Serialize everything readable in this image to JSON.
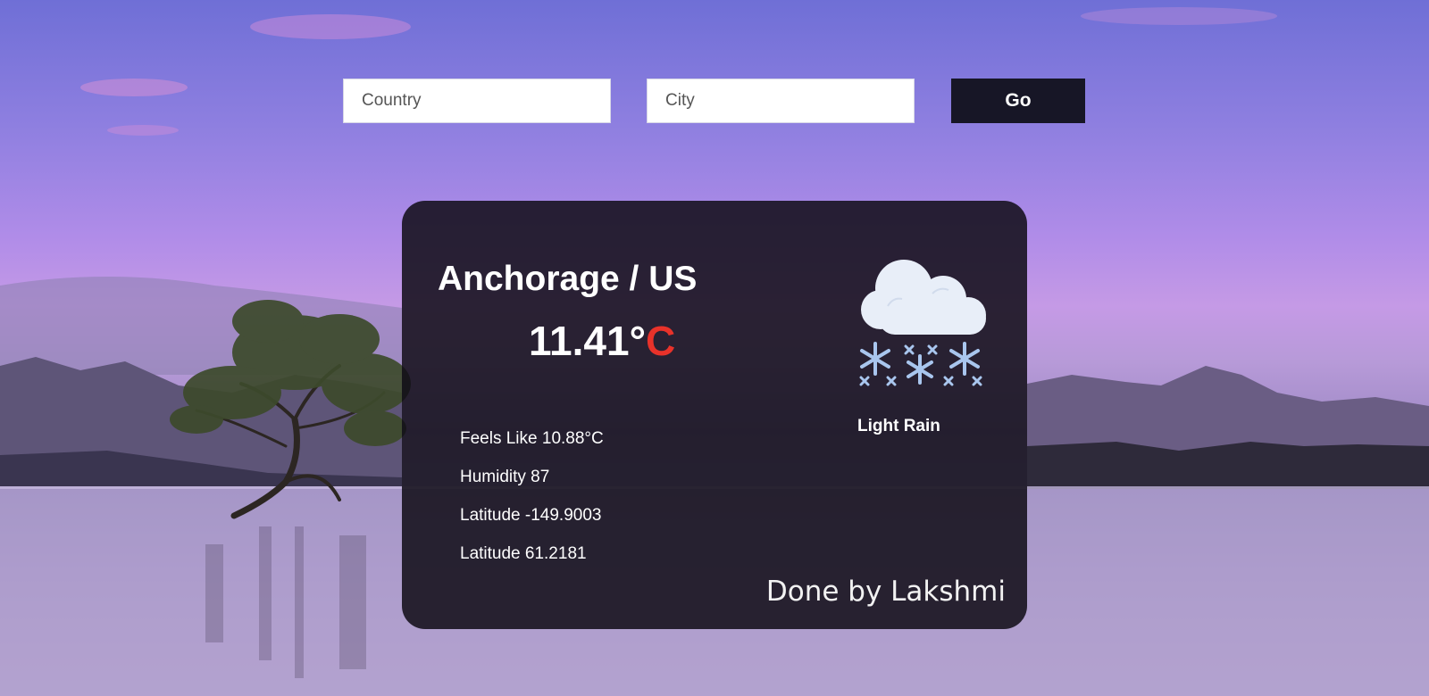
{
  "search": {
    "country_placeholder": "Country",
    "city_placeholder": "City",
    "go_label": "Go"
  },
  "weather": {
    "location": "Anchorage / US",
    "temperature_value": "11.41°",
    "temperature_unit": "C",
    "condition": "Light Rain",
    "icon": "cloud-snow-icon",
    "details": {
      "feels_like": "Feels Like 10.88°C",
      "humidity": "Humidity 87",
      "longitude": "Latitude -149.9003",
      "latitude": "Latitude 61.2181"
    }
  },
  "footer": {
    "credit": "Done by Lakshmi"
  },
  "colors": {
    "accent_unit": "#e8322a",
    "button_bg": "#171626",
    "card_bg": "#100d16"
  }
}
